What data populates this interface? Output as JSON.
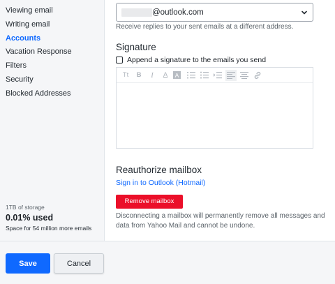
{
  "sidebar": {
    "items": [
      {
        "label": "Viewing email",
        "active": false
      },
      {
        "label": "Writing email",
        "active": false
      },
      {
        "label": "Accounts",
        "active": true
      },
      {
        "label": "Vacation Response",
        "active": false
      },
      {
        "label": "Filters",
        "active": false
      },
      {
        "label": "Security",
        "active": false
      },
      {
        "label": "Blocked Addresses",
        "active": false
      }
    ],
    "storage": {
      "total": "1TB of storage",
      "used": "0.01% used",
      "note": "Space for 54 million more emails"
    }
  },
  "reply_to": {
    "email_domain": "@outlook.com",
    "help": "Receive replies to your sent emails at a different address."
  },
  "signature": {
    "title": "Signature",
    "checkbox_label": "Append a signature to the emails you send",
    "checked": false,
    "toolbar": {
      "text_size_icon": "Tt",
      "bold_icon": "B",
      "italic_icon": "I",
      "font_color_icon": "A",
      "highlight_icon": "A"
    }
  },
  "reauthorize": {
    "title": "Reauthorize mailbox",
    "link": "Sign in to Outlook (Hotmail)"
  },
  "remove": {
    "button": "Remove mailbox",
    "warning": "Disconnecting a mailbox will permanently remove all messages and data from Yahoo Mail and cannot be undone."
  },
  "footer": {
    "save": "Save",
    "cancel": "Cancel"
  },
  "colors": {
    "accent": "#0f69ff",
    "danger": "#eb0f29",
    "panel": "#f5f6f8"
  }
}
